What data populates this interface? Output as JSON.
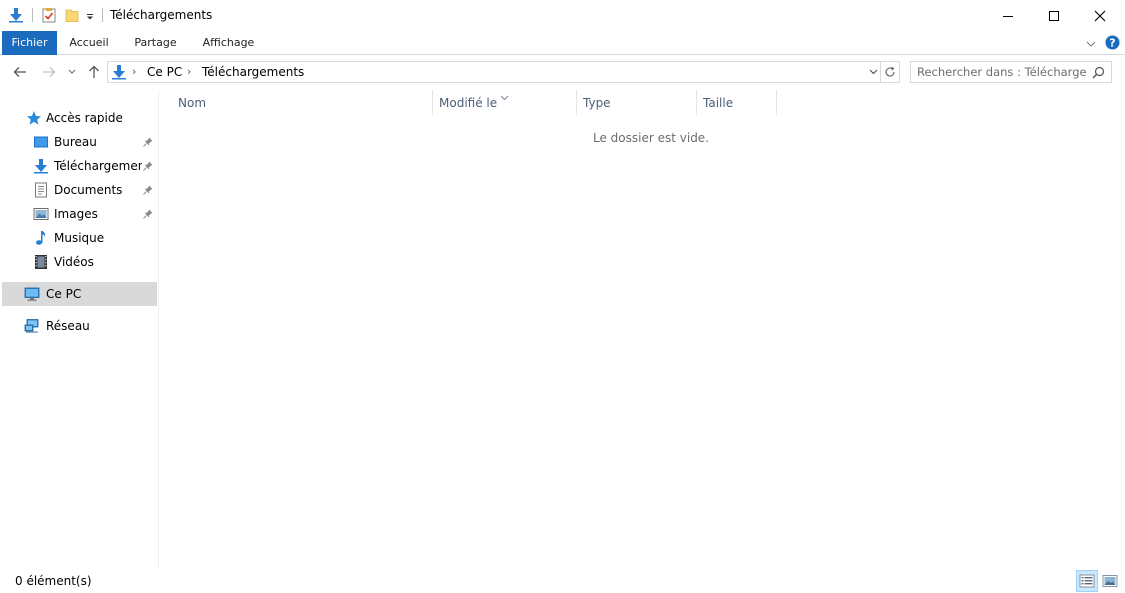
{
  "window": {
    "title": "Téléchargements"
  },
  "quick_access_toolbar": {
    "icons": [
      "download-folder-icon",
      "properties-icon",
      "new-folder-icon",
      "customize-dropdown-icon"
    ]
  },
  "window_controls": {
    "minimize": "minimize",
    "maximize": "maximize",
    "close": "close"
  },
  "ribbon": {
    "tabs": [
      {
        "label": "Fichier",
        "active": true
      },
      {
        "label": "Accueil"
      },
      {
        "label": "Partage"
      },
      {
        "label": "Affichage"
      }
    ],
    "help_symbol": "?"
  },
  "address_bar": {
    "breadcrumbs": [
      "Ce PC",
      "Téléchargements"
    ],
    "separator": "›"
  },
  "search": {
    "placeholder": "Rechercher dans : Télécharge..."
  },
  "nav_pane": {
    "quick_access": {
      "label": "Accès rapide"
    },
    "items": [
      {
        "label": "Bureau",
        "pinned": true
      },
      {
        "label": "Téléchargements",
        "pinned": true
      },
      {
        "label": "Documents",
        "pinned": true
      },
      {
        "label": "Images",
        "pinned": true
      },
      {
        "label": "Musique",
        "pinned": false
      },
      {
        "label": "Vidéos",
        "pinned": false
      }
    ],
    "this_pc": {
      "label": "Ce PC",
      "selected": true
    },
    "network": {
      "label": "Réseau"
    }
  },
  "columns": [
    {
      "label": "Nom"
    },
    {
      "label": "Modifié le",
      "sorted": true
    },
    {
      "label": "Type"
    },
    {
      "label": "Taille"
    }
  ],
  "content": {
    "empty_message": "Le dossier est vide."
  },
  "status_bar": {
    "item_count": "0 élément(s)"
  },
  "colors": {
    "file_tab": "#1a6bbd",
    "selection": "#d9d9d9",
    "column_header_text": "#4c607a",
    "help_icon": "#1a6bbd",
    "folder_blue": "#2b7cd3"
  }
}
